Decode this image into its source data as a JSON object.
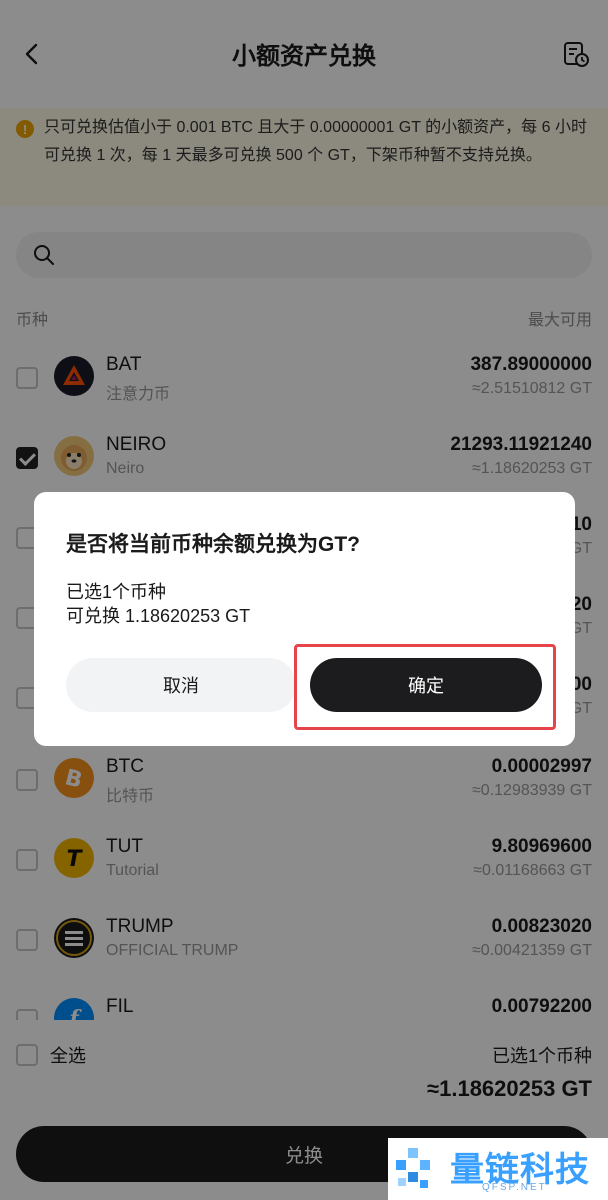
{
  "header": {
    "title": "小额资产兑换",
    "back_icon": "chevron-left-icon",
    "history_icon": "history-clock-icon"
  },
  "notice": {
    "text": "只可兑换估值小于 0.001 BTC 且大于 0.00000001 GT 的小额资产，每 6 小时可兑换 1 次，每 1 天最多可兑换 500 个 GT，下架币种暂不支持兑换。"
  },
  "search": {
    "placeholder": ""
  },
  "list_header": {
    "left": "币种",
    "right": "最大可用"
  },
  "coins": [
    {
      "symbol": "BAT",
      "name": "注意力币",
      "balance": "387.89000000",
      "value": "≈2.51510812 GT",
      "checked": false
    },
    {
      "symbol": "NEIRO",
      "name": "Neiro",
      "balance": "21293.11921240",
      "value": "≈1.18620253 GT",
      "checked": true
    },
    {
      "symbol": "",
      "name": "",
      "balance": "10",
      "value": "GT",
      "checked": false
    },
    {
      "symbol": "",
      "name": "",
      "balance": "20",
      "value": "GT",
      "checked": false
    },
    {
      "symbol": "",
      "name": "",
      "balance": "00",
      "value": "GT",
      "checked": false
    },
    {
      "symbol": "BTC",
      "name": "比特币",
      "balance": "0.00002997",
      "value": "≈0.12983939 GT",
      "checked": false
    },
    {
      "symbol": "TUT",
      "name": "Tutorial",
      "balance": "9.80969600",
      "value": "≈0.01168663 GT",
      "checked": false
    },
    {
      "symbol": "TRUMP",
      "name": "OFFICIAL TRUMP",
      "balance": "0.00823020",
      "value": "≈0.00421359 GT",
      "checked": false
    },
    {
      "symbol": "FIL",
      "name": "",
      "balance": "0.00792200",
      "value": "",
      "checked": false
    }
  ],
  "footer": {
    "select_all": "全选",
    "selected_count": "已选1个币种",
    "total": "≈1.18620253 GT",
    "exchange_button": "兑换"
  },
  "dialog": {
    "title": "是否将当前币种余额兑换为GT?",
    "line1": "已选1个币种",
    "line2": "可兑换 1.18620253 GT",
    "cancel": "取消",
    "confirm": "确定"
  },
  "watermark": {
    "title": "量链科技",
    "subtitle": "QFSP.NET"
  },
  "colors": {
    "highlight": "#e5454a",
    "dark_button": "#1c1c1e",
    "notice_bg": "#fff9e6",
    "notice_icon": "#f0a500",
    "watermark_blue": "#3aa0ff"
  }
}
